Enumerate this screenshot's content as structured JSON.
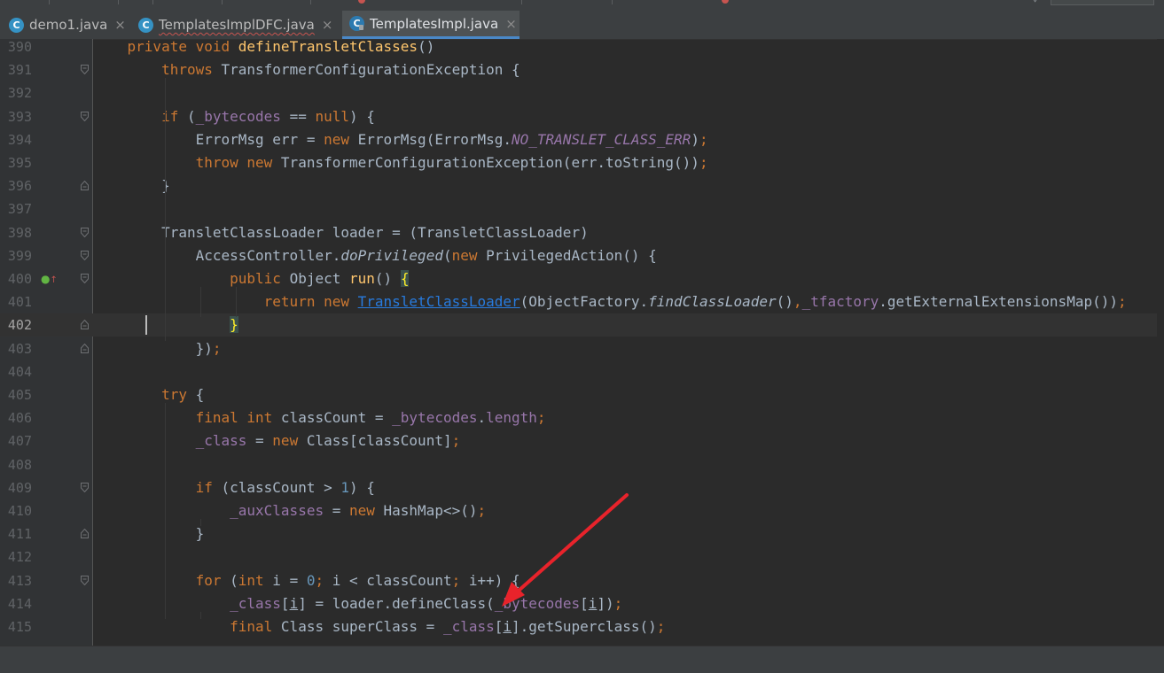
{
  "tabs": [
    {
      "label": "demo1.java",
      "active": false,
      "squiggle": false,
      "icon": "java-class-icon"
    },
    {
      "label": "TemplatesImplDFC.java",
      "active": false,
      "squiggle": true,
      "icon": "java-class-icon"
    },
    {
      "label": "TemplatesImpl.java",
      "active": true,
      "squiggle": false,
      "icon": "java-class-locked-icon"
    }
  ],
  "close_glyph": "×",
  "colors": {
    "keyword": "#cc7832",
    "method_decl": "#ffc66d",
    "field": "#9876aa",
    "number": "#6897bb",
    "link": "#287bde",
    "annotation_arrow": "#e8232b"
  },
  "editor": {
    "current_line": "402",
    "lines": [
      {
        "n": "390",
        "fold": "none",
        "html": "    <span class=\"kw\">private void </span><span class=\"fn\">defineTransletClasses</span>()"
      },
      {
        "n": "391",
        "fold": "start",
        "html": "        <span class=\"kw\">throws </span>TransformerConfigurationException {"
      },
      {
        "n": "392",
        "fold": "none",
        "html": ""
      },
      {
        "n": "393",
        "fold": "start",
        "html": "        <span class=\"kw\">if </span>(<span class=\"field\">_bytecodes</span> == <span class=\"kw\">null</span>) {"
      },
      {
        "n": "394",
        "fold": "none",
        "html": "            ErrorMsg err = <span class=\"kw\">new </span>ErrorMsg(ErrorMsg.<span class=\"const\">NO_TRANSLET_CLASS_ERR</span>)<span class=\"kw\">;</span>"
      },
      {
        "n": "395",
        "fold": "none",
        "html": "            <span class=\"kw\">throw new </span>TransformerConfigurationException(err.toString())<span class=\"kw\">;</span>"
      },
      {
        "n": "396",
        "fold": "end",
        "html": "        }"
      },
      {
        "n": "397",
        "fold": "none",
        "html": ""
      },
      {
        "n": "398",
        "fold": "start",
        "html": "        TransletClassLoader loader = (TransletClassLoader)"
      },
      {
        "n": "399",
        "fold": "start",
        "html": "            AccessController.<span class=\"it\">doPrivileged</span>(<span class=\"kw\">new </span>PrivilegedAction() {"
      },
      {
        "n": "400",
        "fold": "start",
        "html": "                <span class=\"kw\">public </span>Object <span class=\"fn\">run</span>() <span class=\"brace-hl\">{</span>"
      },
      {
        "n": "401",
        "fold": "none",
        "html": "                    <span class=\"kw\">return new </span><span class=\"link\">TransletClassLoader</span>(ObjectFactory.<span class=\"it\">findClassLoader</span>()<span class=\"kw\">,</span><span class=\"field\">_tfactory</span>.getExternalExtensionsMap())<span class=\"kw\">;</span>"
      },
      {
        "n": "402",
        "fold": "end",
        "html": "                <span class=\"brace-hl\">}</span>"
      },
      {
        "n": "403",
        "fold": "end",
        "html": "            })<span class=\"kw\">;</span>"
      },
      {
        "n": "404",
        "fold": "none",
        "html": ""
      },
      {
        "n": "405",
        "fold": "none",
        "html": "        <span class=\"kw\">try </span>{"
      },
      {
        "n": "406",
        "fold": "none",
        "html": "            <span class=\"kw\">final int </span>classCount = <span class=\"field\">_bytecodes</span>.<span class=\"field\">length</span><span class=\"kw\">;</span>"
      },
      {
        "n": "407",
        "fold": "none",
        "html": "            <span class=\"field\">_class </span>= <span class=\"kw\">new </span>Class[classCount]<span class=\"kw\">;</span>"
      },
      {
        "n": "408",
        "fold": "none",
        "html": ""
      },
      {
        "n": "409",
        "fold": "start",
        "html": "            <span class=\"kw\">if </span>(classCount > <span class=\"num\">1</span>) {"
      },
      {
        "n": "410",
        "fold": "none",
        "html": "                <span class=\"field\">_auxClasses </span>= <span class=\"kw\">new </span>HashMap<>()<span class=\"kw\">;</span>"
      },
      {
        "n": "411",
        "fold": "end",
        "html": "            }"
      },
      {
        "n": "412",
        "fold": "none",
        "html": ""
      },
      {
        "n": "413",
        "fold": "start",
        "html": "            <span class=\"kw\">for </span>(<span class=\"kw\">int </span>i = <span class=\"num\">0</span><span class=\"kw\">; </span>i < classCount<span class=\"kw\">; </span>i++) {"
      },
      {
        "n": "414",
        "fold": "none",
        "html": "                <span class=\"field\">_class</span>[<span class=\"ul\">i</span>] = loader.defineClass(<span class=\"field\">_bytecodes</span>[<span class=\"ul\">i</span>])<span class=\"kw\">;</span>"
      },
      {
        "n": "415",
        "fold": "none",
        "html": "                <span class=\"kw\">final </span>Class superClass = <span class=\"field\">_class</span>[<span class=\"ul\">i</span>].getSuperclass()<span class=\"kw\">;</span>"
      }
    ]
  }
}
